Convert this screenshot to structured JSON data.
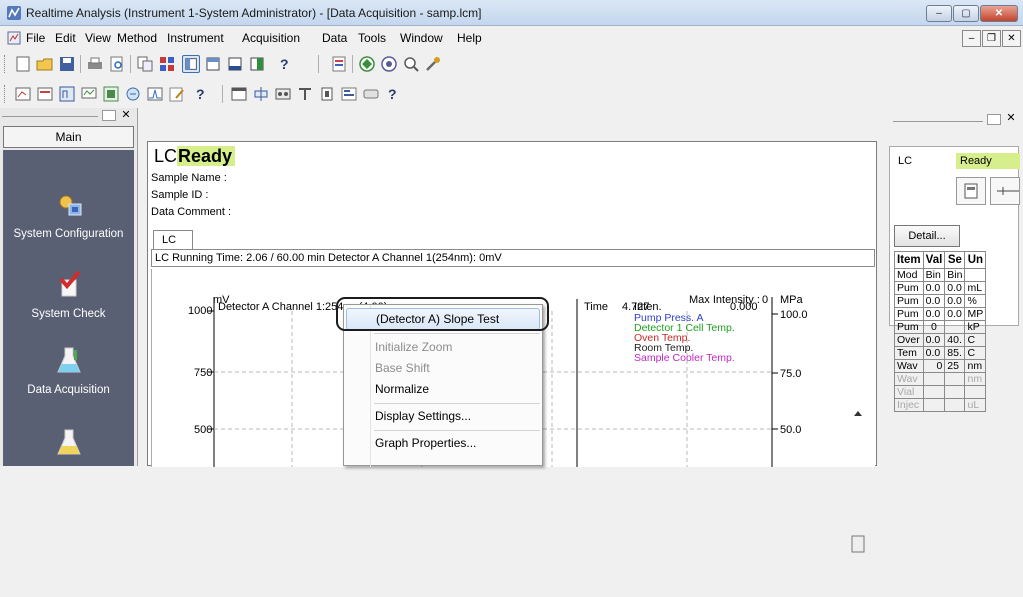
{
  "window": {
    "title": "Realtime Analysis (Instrument 1-System Administrator) - [Data Acquisition - samp.lcm]",
    "minimize_glyph": "–",
    "maximize_glyph": "▢",
    "close_glyph": "✕",
    "mdi_minimize_glyph": "–",
    "mdi_restore_glyph": "❐",
    "mdi_close_glyph": "✕"
  },
  "menubar": {
    "items": [
      "File",
      "Edit",
      "View",
      "Method",
      "Instrument",
      "Acquisition",
      "Data",
      "Tools",
      "Window",
      "Help"
    ]
  },
  "toolbar": {
    "help_glyph": "?"
  },
  "sidebar": {
    "main_label": "Main",
    "items": [
      {
        "label": "System Configuration",
        "icon": "system-configuration-icon"
      },
      {
        "label": "System Check",
        "icon": "system-check-icon"
      },
      {
        "label": "Data Acquisition",
        "icon": "data-acquisition-icon"
      },
      {
        "label": "",
        "icon": "postrun-icon"
      }
    ]
  },
  "status": {
    "prefix": "LC",
    "state": "Ready",
    "accent": "#d6ee8c"
  },
  "sample": {
    "name_label": "Sample Name :",
    "id_label": "Sample ID :",
    "comment_label": "Data Comment :"
  },
  "tabs": [
    "LC"
  ],
  "run_info": "LC Running Time: 2.06 / 60.00 min Detector A Channel 1(254nm): 0mV",
  "chart": {
    "y_unit_left": "mV",
    "y_unit_right": "MPa",
    "series_label": "Detector A Channel 1:254nm(4.00)",
    "time_label": "Time",
    "time_value": "4.727",
    "max_intensity_label": "Max Intensity :",
    "max_intensity_value": "0",
    "inten_label": "Inten.",
    "inten_value": "0.000",
    "legend": [
      {
        "label": "Pump Press. A",
        "color": "#2f3fc8"
      },
      {
        "label": "Detector 1 Cell Temp.",
        "color": "#20a020"
      },
      {
        "label": "Oven Temp.",
        "color": "#c82828"
      },
      {
        "label": "Room Temp.",
        "color": "#202020"
      },
      {
        "label": "Sample Cooler Temp.",
        "color": "#c028c0"
      }
    ],
    "left_ticks": [
      "1000",
      "750",
      "500"
    ],
    "right_ticks": [
      "100.0",
      "75.0",
      "50.0"
    ]
  },
  "chart_data": {
    "type": "line",
    "ylabel": "mV",
    "y2label": "MPa",
    "yticks": [
      1000,
      750,
      500
    ],
    "y2ticks": [
      100.0,
      75.0,
      50.0
    ],
    "series": [
      {
        "name": "Detector A Channel 1:254nm(4.00)",
        "values": []
      }
    ]
  },
  "context_menu": {
    "items": [
      {
        "label": "(Detector A) Slope Test",
        "enabled": true,
        "highlighted": true
      },
      {
        "label": "Initialize Zoom",
        "enabled": false
      },
      {
        "label": "Base Shift",
        "enabled": false
      },
      {
        "label": "Normalize",
        "enabled": true
      },
      {
        "label": "Display Settings...",
        "enabled": true
      },
      {
        "label": "Graph Properties...",
        "enabled": true
      }
    ]
  },
  "right_panel": {
    "lc_label": "LC",
    "state": "Ready",
    "detail_button": "Detail...",
    "table": {
      "headers": [
        "Item",
        "Val",
        "Se",
        "Un"
      ],
      "rows": [
        [
          "Mod",
          "Bin",
          "Bin",
          ""
        ],
        [
          "Pum",
          "0.0",
          "0.0",
          "mL"
        ],
        [
          "Pum",
          "0.0",
          "0.0",
          "%"
        ],
        [
          "Pum",
          "0.0",
          "0.0",
          "MP"
        ],
        [
          "Pum",
          "0",
          "",
          "kP"
        ],
        [
          "Over",
          "0.0",
          "40.",
          "C"
        ],
        [
          "Tem",
          "0.0",
          "85.",
          "C"
        ],
        [
          "Wav",
          "0",
          "25",
          "nm"
        ],
        [
          "Wav",
          "",
          "",
          "nm"
        ],
        [
          "Vial",
          "",
          "",
          ""
        ],
        [
          "Injec",
          "",
          "",
          "uL"
        ]
      ]
    }
  }
}
